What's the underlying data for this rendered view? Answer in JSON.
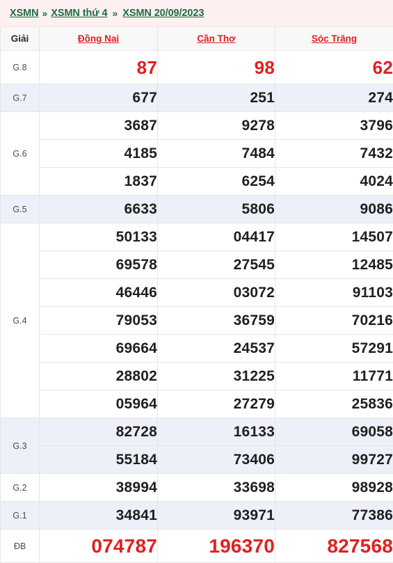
{
  "breadcrumb": {
    "items": [
      {
        "label": "XSMN"
      },
      {
        "label": "XSMN thứ 4"
      },
      {
        "label": "XSMN 20/09/2023"
      }
    ],
    "separator": "»"
  },
  "table": {
    "headers": {
      "prize_column": "Giải",
      "provinces": [
        "Đồng Nai",
        "Cần Thơ",
        "Sóc Trăng"
      ]
    },
    "rows": [
      {
        "prize": "G.8",
        "style": "highlight-red",
        "values": [
          [
            "87"
          ],
          [
            "98"
          ],
          [
            "62"
          ]
        ]
      },
      {
        "prize": "G.7",
        "style": "normal",
        "values": [
          [
            "677"
          ],
          [
            "251"
          ],
          [
            "274"
          ]
        ]
      },
      {
        "prize": "G.6",
        "style": "normal",
        "values": [
          [
            "3687",
            "4185",
            "1837"
          ],
          [
            "9278",
            "7484",
            "6254"
          ],
          [
            "3796",
            "7432",
            "4024"
          ]
        ]
      },
      {
        "prize": "G.5",
        "style": "normal",
        "values": [
          [
            "6633"
          ],
          [
            "5806"
          ],
          [
            "9086"
          ]
        ]
      },
      {
        "prize": "G.4",
        "style": "normal",
        "values": [
          [
            "50133",
            "69578",
            "46446",
            "79053",
            "69664",
            "28802",
            "05964"
          ],
          [
            "04417",
            "27545",
            "03072",
            "36759",
            "24537",
            "31225",
            "27279"
          ],
          [
            "14507",
            "12485",
            "91103",
            "70216",
            "57291",
            "11771",
            "25836"
          ]
        ]
      },
      {
        "prize": "G.3",
        "style": "normal",
        "values": [
          [
            "82728",
            "55184"
          ],
          [
            "16133",
            "73406"
          ],
          [
            "69058",
            "99727"
          ]
        ]
      },
      {
        "prize": "G.2",
        "style": "normal",
        "values": [
          [
            "38994"
          ],
          [
            "33698"
          ],
          [
            "98928"
          ]
        ]
      },
      {
        "prize": "G.1",
        "style": "normal",
        "values": [
          [
            "34841"
          ],
          [
            "93971"
          ],
          [
            "77386"
          ]
        ]
      },
      {
        "prize": "ĐB",
        "style": "highlight-red",
        "values": [
          [
            "074787"
          ],
          [
            "196370"
          ],
          [
            "827568"
          ]
        ]
      }
    ]
  },
  "colors": {
    "breadcrumb_bg": "#fdf0f0",
    "breadcrumb_link": "#1e6b43",
    "province_header": "#e02020",
    "highlight_number": "#e02020",
    "number": "#1f1f1f",
    "alt_row_bg": "#eef0f9",
    "header_row_bg": "#f8f8f8",
    "border": "#e6e6e6"
  }
}
